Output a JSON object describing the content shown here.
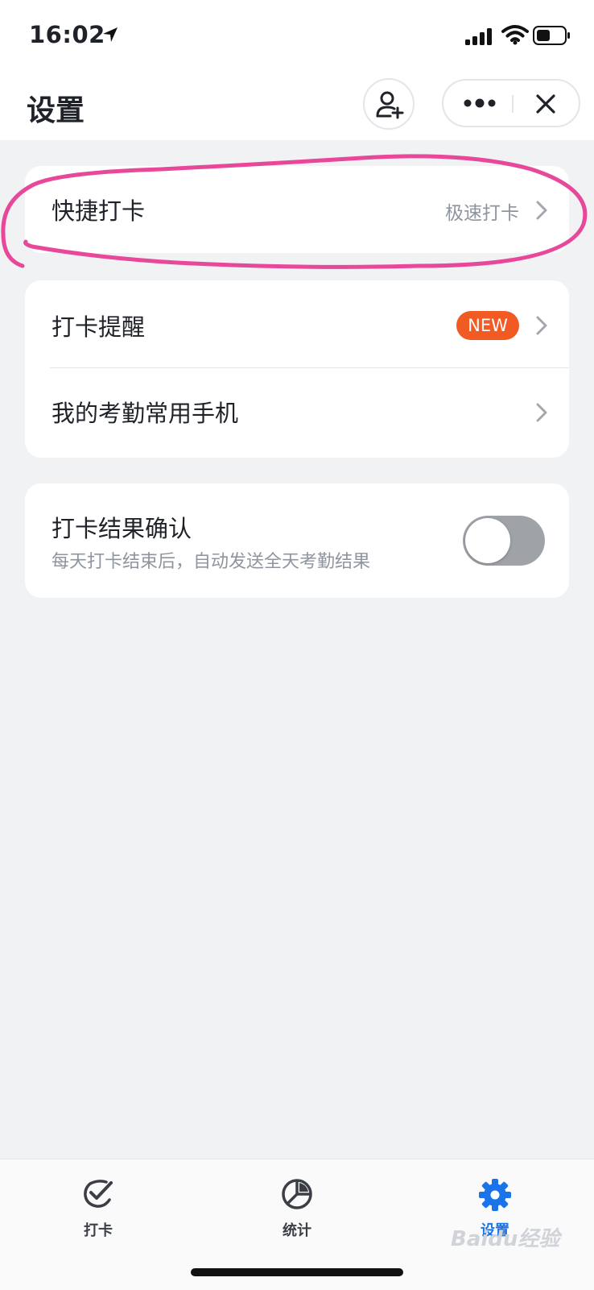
{
  "status_bar": {
    "time": "16:02"
  },
  "nav": {
    "title": "设置",
    "icons": [
      "add-user-icon",
      "more-icon",
      "close-icon"
    ]
  },
  "cards": {
    "quick_clockin": {
      "label": "快捷打卡",
      "value": "极速打卡"
    },
    "reminder": {
      "label": "打卡提醒",
      "badge": "NEW"
    },
    "phone": {
      "label": "我的考勤常用手机"
    },
    "confirm": {
      "label": "打卡结果确认",
      "sub": "每天打卡结束后，自动发送全天考勤结果",
      "toggle_on": false
    }
  },
  "tabs": [
    {
      "label": "打卡",
      "icon": "checkmark-icon",
      "active": false
    },
    {
      "label": "统计",
      "icon": "pie-chart-icon",
      "active": false
    },
    {
      "label": "设置",
      "icon": "gear-icon",
      "active": true
    }
  ],
  "watermark": "Baidu经验",
  "colors": {
    "accent": "#1a73e8",
    "badge": "#f25a23",
    "annotation": "#e8489a"
  }
}
